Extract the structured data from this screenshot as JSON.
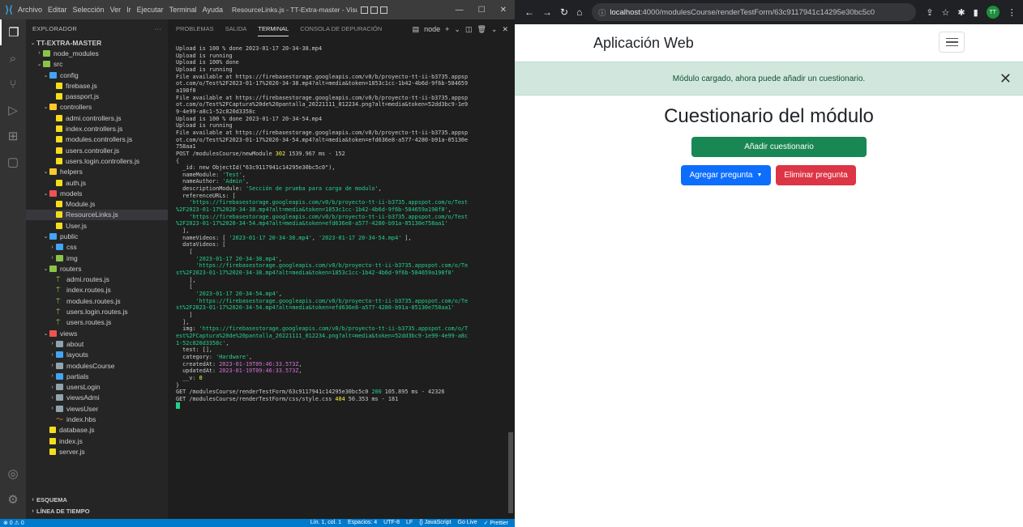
{
  "vscode": {
    "menu": [
      "Archivo",
      "Editar",
      "Selección",
      "Ver",
      "Ir",
      "Ejecutar",
      "Terminal",
      "Ayuda"
    ],
    "window_title": "ResourceLinks.js - TT-Extra-master - Visual Studio ...",
    "explorer_label": "EXPLORADOR",
    "tree": [
      {
        "label": "TT-EXTRA-MASTER",
        "indent": 0,
        "chev": "v",
        "icon": "none"
      },
      {
        "label": "node_modules",
        "indent": 1,
        "chev": ">",
        "icon": "folder green"
      },
      {
        "label": "src",
        "indent": 1,
        "chev": "v",
        "icon": "folder green"
      },
      {
        "label": "config",
        "indent": 2,
        "chev": "v",
        "icon": "folder blue"
      },
      {
        "label": "firebase.js",
        "indent": 3,
        "chev": "",
        "icon": "js"
      },
      {
        "label": "passport.js",
        "indent": 3,
        "chev": "",
        "icon": "js"
      },
      {
        "label": "controllers",
        "indent": 2,
        "chev": "v",
        "icon": "folder yellow"
      },
      {
        "label": "admi.controllers.js",
        "indent": 3,
        "chev": "",
        "icon": "js"
      },
      {
        "label": "index.controllers.js",
        "indent": 3,
        "chev": "",
        "icon": "js"
      },
      {
        "label": "modules.controllers.js",
        "indent": 3,
        "chev": "",
        "icon": "js"
      },
      {
        "label": "users.controller.js",
        "indent": 3,
        "chev": "",
        "icon": "js"
      },
      {
        "label": "users.login.controllers.js",
        "indent": 3,
        "chev": "",
        "icon": "js"
      },
      {
        "label": "helpers",
        "indent": 2,
        "chev": "v",
        "icon": "folder yellow"
      },
      {
        "label": "auth.js",
        "indent": 3,
        "chev": "",
        "icon": "js"
      },
      {
        "label": "models",
        "indent": 2,
        "chev": "v",
        "icon": "folder red"
      },
      {
        "label": "Module.js",
        "indent": 3,
        "chev": "",
        "icon": "js"
      },
      {
        "label": "ResourceLinks.js",
        "indent": 3,
        "chev": "",
        "icon": "js",
        "selected": true
      },
      {
        "label": "User.js",
        "indent": 3,
        "chev": "",
        "icon": "js"
      },
      {
        "label": "public",
        "indent": 2,
        "chev": "v",
        "icon": "folder blue"
      },
      {
        "label": "css",
        "indent": 3,
        "chev": ">",
        "icon": "folder blue"
      },
      {
        "label": "img",
        "indent": 3,
        "chev": ">",
        "icon": "folder green"
      },
      {
        "label": "routers",
        "indent": 2,
        "chev": "v",
        "icon": "folder green"
      },
      {
        "label": "admi.routes.js",
        "indent": 3,
        "chev": "",
        "icon": "route"
      },
      {
        "label": "index.routes.js",
        "indent": 3,
        "chev": "",
        "icon": "route"
      },
      {
        "label": "modules.routes.js",
        "indent": 3,
        "chev": "",
        "icon": "route"
      },
      {
        "label": "users.login.routes.js",
        "indent": 3,
        "chev": "",
        "icon": "route"
      },
      {
        "label": "users.routes.js",
        "indent": 3,
        "chev": "",
        "icon": "route"
      },
      {
        "label": "views",
        "indent": 2,
        "chev": "v",
        "icon": "folder red"
      },
      {
        "label": "about",
        "indent": 3,
        "chev": ">",
        "icon": "folder grey"
      },
      {
        "label": "layouts",
        "indent": 3,
        "chev": ">",
        "icon": "folder blue"
      },
      {
        "label": "modulesCourse",
        "indent": 3,
        "chev": ">",
        "icon": "folder grey"
      },
      {
        "label": "partials",
        "indent": 3,
        "chev": ">",
        "icon": "folder blue"
      },
      {
        "label": "usersLogin",
        "indent": 3,
        "chev": ">",
        "icon": "folder grey"
      },
      {
        "label": "viewsAdmi",
        "indent": 3,
        "chev": ">",
        "icon": "folder grey"
      },
      {
        "label": "viewsUser",
        "indent": 3,
        "chev": ">",
        "icon": "folder grey"
      },
      {
        "label": "index.hbs",
        "indent": 3,
        "chev": "",
        "icon": "hbs"
      },
      {
        "label": "database.js",
        "indent": 2,
        "chev": "",
        "icon": "js"
      },
      {
        "label": "index.js",
        "indent": 2,
        "chev": "",
        "icon": "js"
      },
      {
        "label": "server.js",
        "indent": 2,
        "chev": "",
        "icon": "js"
      }
    ],
    "outline_label": "ESQUEMA",
    "timeline_label": "LÍNEA DE TIEMPO",
    "panel_tabs": [
      "PROBLEMAS",
      "SALIDA",
      "TERMINAL",
      "CONSOLA DE DEPURACIÓN"
    ],
    "active_panel_tab": "TERMINAL",
    "terminal_shell": "node",
    "terminal_lines": [
      [
        [
          "Upload is 100 % done 2023-01-17 20-34-38.mp4",
          ""
        ]
      ],
      [
        [
          "Upload is running",
          ""
        ]
      ],
      [
        [
          "Upload is 100% done",
          ""
        ]
      ],
      [
        [
          "Upload is running",
          ""
        ]
      ],
      [
        [
          "File available at https://firebasestorage.googleapis.com/v0/b/proyecto-tt-ii-b3735.appsp",
          ""
        ]
      ],
      [
        [
          "ot.com/o/Test%2F2023-01-17%2020-34-38.mp4?alt=media&token=1853c1cc-1b42-4b6d-9f6b-584659",
          ""
        ]
      ],
      [
        [
          "a198f0",
          ""
        ]
      ],
      [
        [
          "File available at https://firebasestorage.googleapis.com/v0/b/proyecto-tt-ii-b3735.appsp",
          ""
        ]
      ],
      [
        [
          "ot.com/o/Test%2FCaptura%20de%20pantalla_20221111_012234.png?alt=media&token=52dd3bc9-1e9",
          ""
        ]
      ],
      [
        [
          "9-4e99-a8c1-52c820d3358c",
          ""
        ]
      ],
      [
        [
          "Upload is 100 % done 2023-01-17 20-34-54.mp4",
          ""
        ]
      ],
      [
        [
          "Upload is running",
          ""
        ]
      ],
      [
        [
          "File available at https://firebasestorage.googleapis.com/v0/b/proyecto-tt-ii-b3735.appsp",
          ""
        ]
      ],
      [
        [
          "ot.com/o/Test%2F2023-01-17%2020-34-54.mp4?alt=media&token=efd636e8-a577-4280-b91a-05130e",
          ""
        ]
      ],
      [
        [
          "758aa1",
          ""
        ]
      ],
      [
        [
          "POST /modulesCourse/newModule ",
          ""
        ],
        [
          "302",
          "t-num"
        ],
        [
          " 1539.967 ms - 152",
          ""
        ]
      ],
      [
        [
          "{",
          ""
        ]
      ],
      [
        [
          "  _id: new ObjectId(\"63c9117941c14295e30bc5c0\"),",
          ""
        ]
      ],
      [
        [
          "  nameModule: ",
          ""
        ],
        [
          "'Test'",
          "t-str"
        ],
        [
          ",",
          ""
        ]
      ],
      [
        [
          "  nameAuthor: ",
          ""
        ],
        [
          "'Admin'",
          "t-str"
        ],
        [
          ",",
          ""
        ]
      ],
      [
        [
          "  descriptionModule: ",
          ""
        ],
        [
          "'Sección de prueba para carga de modulo'",
          "t-str"
        ],
        [
          ",",
          ""
        ]
      ],
      [
        [
          "  referenceURLs: [",
          ""
        ]
      ],
      [
        [
          "    'https://firebasestorage.googleapis.com/v0/b/proyecto-tt-ii-b3735.appspot.com/o/Test",
          "t-str"
        ]
      ],
      [
        [
          "%2F2023-01-17%2020-34-38.mp4?alt=media&token=1853c1cc-1b42-4b6d-9f6b-584659a198f0'",
          "t-str"
        ],
        [
          ",",
          ""
        ]
      ],
      [
        [
          "    'https://firebasestorage.googleapis.com/v0/b/proyecto-tt-ii-b3735.appspot.com/o/Test",
          "t-str"
        ]
      ],
      [
        [
          "%2F2023-01-17%2020-34-54.mp4?alt=media&token=efd636e8-a577-4280-b91a-05130e758aa1'",
          "t-str"
        ]
      ],
      [
        [
          "  ],",
          ""
        ]
      ],
      [
        [
          "  nameVideos: [ ",
          ""
        ],
        [
          "'2023-01-17 20-34-38.mp4'",
          "t-str"
        ],
        [
          ", ",
          ""
        ],
        [
          "'2023-01-17 20-34-54.mp4'",
          "t-str"
        ],
        [
          " ],",
          ""
        ]
      ],
      [
        [
          "  dataVideos: [",
          ""
        ]
      ],
      [
        [
          "    [",
          ""
        ]
      ],
      [
        [
          "      '2023-01-17 20-34-38.mp4'",
          "t-str"
        ],
        [
          ",",
          ""
        ]
      ],
      [
        [
          "      'https://firebasestorage.googleapis.com/v0/b/proyecto-tt-ii-b3735.appspot.com/o/Te",
          "t-str"
        ]
      ],
      [
        [
          "st%2F2023-01-17%2020-34-38.mp4?alt=media&token=1853c1cc-1b42-4b6d-9f6b-584659a198f0'",
          "t-str"
        ]
      ],
      [
        [
          "    ],",
          ""
        ]
      ],
      [
        [
          "    [",
          ""
        ]
      ],
      [
        [
          "      '2023-01-17 20-34-54.mp4'",
          "t-str"
        ],
        [
          ",",
          ""
        ]
      ],
      [
        [
          "      'https://firebasestorage.googleapis.com/v0/b/proyecto-tt-ii-b3735.appspot.com/o/Te",
          "t-str"
        ]
      ],
      [
        [
          "st%2F2023-01-17%2020-34-54.mp4?alt=media&token=efd636e8-a577-4280-b91a-05130e758aa1'",
          "t-str"
        ]
      ],
      [
        [
          "    ]",
          ""
        ]
      ],
      [
        [
          "  ],",
          ""
        ]
      ],
      [
        [
          "  img: ",
          ""
        ],
        [
          "'https://firebasestorage.googleapis.com/v0/b/proyecto-tt-ii-b3735.appspot.com/o/T",
          "t-str"
        ]
      ],
      [
        [
          "est%2FCaptura%20de%20pantalla_20221111_012234.png?alt=media&token=52dd3bc9-1e99-4e99-a8c",
          "t-str"
        ]
      ],
      [
        [
          "1-52c820d3358c'",
          "t-str"
        ],
        [
          ",",
          ""
        ]
      ],
      [
        [
          "  test: [],",
          ""
        ]
      ],
      [
        [
          "  category: ",
          ""
        ],
        [
          "'Hardware'",
          "t-str"
        ],
        [
          ",",
          ""
        ]
      ],
      [
        [
          "  createdAt: ",
          ""
        ],
        [
          "2023-01-19T09:46:33.573Z",
          "t-date"
        ],
        [
          ",",
          ""
        ]
      ],
      [
        [
          "  updatedAt: ",
          ""
        ],
        [
          "2023-01-19T09:46:33.573Z",
          "t-date"
        ],
        [
          ",",
          ""
        ]
      ],
      [
        [
          "  __v: ",
          ""
        ],
        [
          "0",
          "t-num"
        ]
      ],
      [
        [
          "}",
          ""
        ]
      ],
      [
        [
          "GET /modulesCourse/renderTestForm/63c9117941c14295e30bc5c0 ",
          ""
        ],
        [
          "200",
          "t-grn"
        ],
        [
          " 105.895 ms - 42326",
          ""
        ]
      ],
      [
        [
          "GET /modulesCourse/renderTestForm/css/style.css ",
          ""
        ],
        [
          "404",
          "t-num"
        ],
        [
          " 50.353 ms - 181",
          ""
        ]
      ]
    ],
    "status_left": "⊗ 0 ⚠ 0",
    "status_right": [
      "Lín. 1, col. 1",
      "Espacios: 4",
      "UTF-8",
      "LF",
      "{} JavaScript",
      "Go Live",
      "✓ Prettier"
    ]
  },
  "browser": {
    "url_host": "localhost",
    "url_path": ":4000/modulesCourse/renderTestForm/63c9117941c14295e30bc5c0",
    "avatar_initials": "TT",
    "brand": "Aplicación Web",
    "alert_text": "Módulo cargado, ahora puede añadir un cuestionario.",
    "heading": "Cuestionario del módulo",
    "add_quiz_label": "Añadir cuestionario",
    "add_question_label": "Agregar pregunta",
    "delete_question_label": "Eliminar pregunta"
  }
}
